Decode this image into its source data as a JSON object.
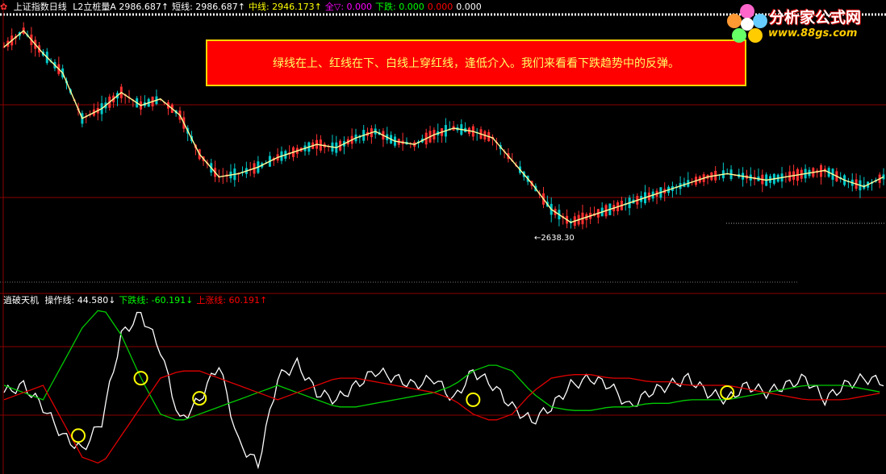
{
  "header": {
    "icon": "gear-icon",
    "title": "上证指数日线",
    "items": [
      {
        "label": "L2立桩量A",
        "value": "2986.687",
        "arrow": "↑",
        "color": "#ffffff"
      },
      {
        "label": "短线:",
        "value": "2986.687",
        "arrow": "↑",
        "color": "#ffffff"
      },
      {
        "label": "中线:",
        "value": "2946.173",
        "arrow": "↑",
        "color": "#ffff00"
      },
      {
        "label": "全▽:",
        "value": "0.000",
        "arrow": "",
        "color": "#ff00ff"
      },
      {
        "label": "下跌:",
        "value": "0.000",
        "arrow": "",
        "color": "#00ff00"
      },
      {
        "label": "",
        "value": "0.000",
        "arrow": "",
        "color": "#ff0000"
      },
      {
        "label": "",
        "value": "0.000",
        "arrow": "",
        "color": "#ffffff"
      }
    ]
  },
  "callout": {
    "text": "绿线在上、红线在下、白线上穿红线，逢低介入。我们来看看下跌趋势中的反弹。"
  },
  "logo": {
    "name": "分析家公式网",
    "url": "www.88gs.com"
  },
  "price_low_label": "←2638.30",
  "sub_panel": {
    "title": "逍破天机",
    "items": [
      {
        "label": "操作线:",
        "value": "44.580",
        "arrow": "↓",
        "color": "#ffffff"
      },
      {
        "label": "下跌线:",
        "value": "-60.191",
        "arrow": "↓",
        "color": "#00ff00"
      },
      {
        "label": "上涨线:",
        "value": "60.191",
        "arrow": "↑",
        "color": "#ff0000"
      }
    ]
  },
  "colors": {
    "up_candle": "#ff3030",
    "down_candle": "#00c8c8",
    "grid": "#8b0000",
    "ma_line": "#ffff99",
    "operation_line": "#ffffff",
    "decline_line": "#00cc00",
    "rise_line": "#e00000",
    "marker": "#ffff00"
  },
  "chart_data": [
    {
      "type": "line",
      "title": "上证指数日线",
      "series": [
        {
          "name": "L2立桩量A",
          "x": [
            0,
            5,
            10,
            15,
            20,
            25,
            30,
            35,
            40,
            45,
            50,
            55,
            60,
            65,
            70,
            75,
            80,
            85,
            90,
            95,
            100,
            105,
            110,
            115,
            120,
            125,
            130,
            135,
            140,
            145,
            150,
            155,
            160,
            165,
            170,
            175,
            180,
            185,
            190,
            195,
            200,
            205,
            210,
            215,
            220,
            225
          ],
          "values": [
            3200,
            3250,
            3180,
            3120,
            2980,
            3010,
            3060,
            3020,
            3040,
            2990,
            2870,
            2800,
            2810,
            2830,
            2860,
            2880,
            2900,
            2890,
            2920,
            2940,
            2910,
            2900,
            2930,
            2950,
            2940,
            2920,
            2850,
            2780,
            2700,
            2660,
            2680,
            2700,
            2720,
            2740,
            2760,
            2780,
            2800,
            2810,
            2800,
            2790,
            2800,
            2810,
            2820,
            2790,
            2770,
            2800
          ]
        }
      ],
      "low_label": {
        "x": 130,
        "y": 2638.3,
        "text": "←2638.30"
      }
    },
    {
      "type": "line",
      "title": "逍破天机",
      "x": [
        0,
        5,
        10,
        15,
        20,
        25,
        30,
        35,
        40,
        45,
        50,
        55,
        60,
        65,
        70,
        75,
        80,
        85,
        90,
        95,
        100,
        105,
        110,
        115,
        120,
        125,
        130,
        135,
        140,
        145,
        150,
        155,
        160,
        165,
        170,
        175,
        180,
        185,
        190,
        195,
        200,
        205,
        210,
        215,
        220,
        225
      ],
      "series": [
        {
          "name": "操作线",
          "values": [
            0,
            10,
            -20,
            -60,
            -80,
            -40,
            80,
            110,
            60,
            -40,
            -10,
            40,
            -70,
            -100,
            20,
            40,
            0,
            -10,
            10,
            30,
            20,
            10,
            20,
            -10,
            30,
            10,
            -20,
            -40,
            -20,
            10,
            20,
            10,
            -20,
            0,
            10,
            20,
            0,
            -10,
            10,
            0,
            10,
            20,
            -10,
            10,
            20,
            15
          ]
        },
        {
          "name": "下跌线",
          "values": [
            10,
            0,
            -10,
            40,
            90,
            120,
            80,
            20,
            -30,
            -40,
            -30,
            -20,
            -10,
            0,
            10,
            0,
            -10,
            -20,
            -20,
            -15,
            -10,
            -5,
            0,
            10,
            30,
            40,
            30,
            0,
            -20,
            -25,
            -25,
            -20,
            -20,
            -15,
            -15,
            -10,
            -10,
            -10,
            -5,
            0,
            5,
            10,
            10,
            10,
            5,
            0
          ]
        },
        {
          "name": "上涨线",
          "values": [
            -10,
            0,
            10,
            -40,
            -90,
            -100,
            -60,
            -20,
            20,
            30,
            30,
            20,
            10,
            0,
            -10,
            0,
            10,
            20,
            20,
            15,
            10,
            5,
            0,
            -10,
            -30,
            -40,
            -30,
            0,
            20,
            25,
            25,
            20,
            20,
            15,
            15,
            10,
            10,
            10,
            5,
            0,
            -5,
            -10,
            -10,
            -10,
            -5,
            0
          ]
        }
      ],
      "ylim": [
        -110,
        120
      ]
    }
  ]
}
